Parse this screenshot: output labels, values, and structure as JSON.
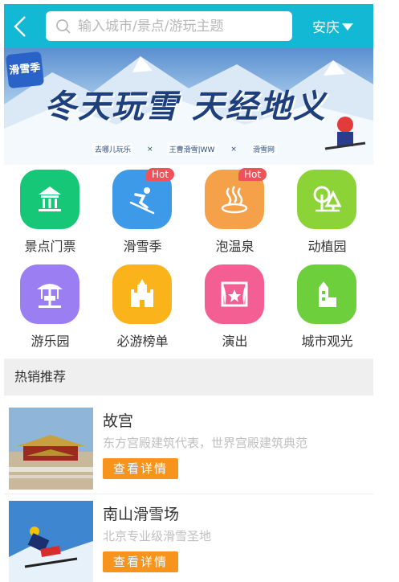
{
  "header": {
    "search_placeholder": "输入城市/景点/游玩主题",
    "city": "安庆"
  },
  "banner": {
    "logo_text": "滑雪季",
    "title": "冬天玩雪 天经地义",
    "partners": [
      "去哪儿玩乐",
      "×",
      "王曹滑雪|WW",
      "×",
      "滑雪网"
    ]
  },
  "categories": [
    {
      "label": "景点门票",
      "icon": "temple-icon",
      "color": "#16c777",
      "hot": ""
    },
    {
      "label": "滑雪季",
      "icon": "skier-icon",
      "color": "#3d9ae8",
      "hot": "Hot"
    },
    {
      "label": "泡温泉",
      "icon": "hot-spring-icon",
      "color": "#f5a14a",
      "hot": "Hot"
    },
    {
      "label": "动植园",
      "icon": "tree-icon",
      "color": "#8cd338",
      "hot": ""
    },
    {
      "label": "游乐园",
      "icon": "carousel-icon",
      "color": "#9b7ff2",
      "hot": ""
    },
    {
      "label": "必游榜单",
      "icon": "castle-icon",
      "color": "#fbb31b",
      "hot": ""
    },
    {
      "label": "演出",
      "icon": "stage-icon",
      "color": "#f45f93",
      "hot": ""
    },
    {
      "label": "城市观光",
      "icon": "tower-icon",
      "color": "#6ecf3c",
      "hot": ""
    }
  ],
  "section_title": "热销推荐",
  "items": [
    {
      "name": "故宫",
      "desc": "东方宫殿建筑代表，世界宫殿建筑典范",
      "button": "查看详情"
    },
    {
      "name": "南山滑雪场",
      "desc": "北京专业级滑雪圣地",
      "button": "查看详情"
    }
  ]
}
